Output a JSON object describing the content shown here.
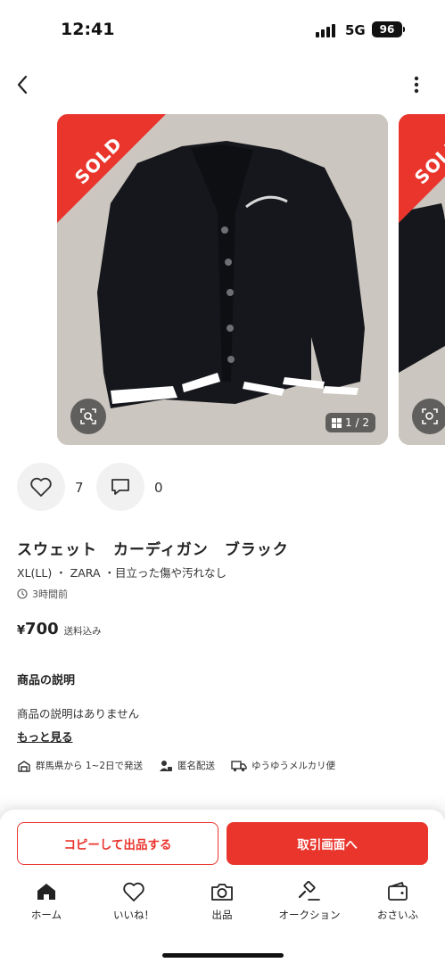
{
  "status_bar": {
    "time": "12:41",
    "network": "5G",
    "battery": "96"
  },
  "gallery": {
    "sold_label": "SOLD",
    "counter": "1 / 2"
  },
  "actions": {
    "like_count": "7",
    "comment_count": "0"
  },
  "item": {
    "title": "スウェット　カーディガン　ブラック",
    "subtitle": "XL(LL) ・ ZARA ・目立った傷や汚れなし",
    "posted": "3時間前",
    "currency": "¥",
    "price": "700",
    "shipping_note": "送料込み"
  },
  "description": {
    "heading": "商品の説明",
    "body": "商品の説明はありません",
    "more_link": "もっと見る"
  },
  "meta": {
    "shipping_from": "群馬県から 1~2日で発送",
    "anonymous": "匿名配送",
    "method": "ゆうゆうメルカリ便"
  },
  "buttons": {
    "copy_listing": "コピーして出品する",
    "trade_screen": "取引画面へ"
  },
  "tabbar": {
    "items": [
      {
        "label": "ホーム",
        "icon": "home-icon"
      },
      {
        "label": "いいね！",
        "icon": "heart-icon"
      },
      {
        "label": "出品",
        "icon": "camera-icon"
      },
      {
        "label": "オークション",
        "icon": "gavel-icon"
      },
      {
        "label": "おさいふ",
        "icon": "wallet-icon"
      }
    ]
  },
  "colors": {
    "accent": "#ea352d",
    "photo_background": "#c9c4bd",
    "garment": "#15171c"
  }
}
